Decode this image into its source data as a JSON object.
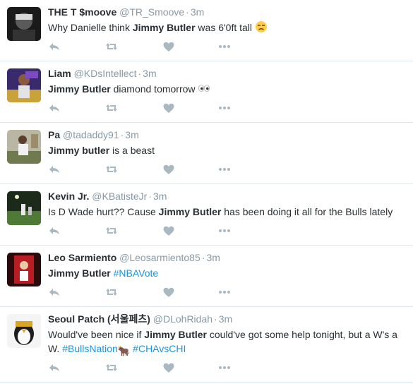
{
  "tweets": [
    {
      "name": "THE T $moove",
      "handle": "@TR_Smoove",
      "time": "3m",
      "parts": [
        {
          "t": "Why Danielle think "
        },
        {
          "t": "Jimmy Butler",
          "b": true
        },
        {
          "t": " was 6'0ft tall "
        }
      ],
      "emoji": "unamused-face-icon"
    },
    {
      "name": "Liam",
      "handle": "@KDsIntellect",
      "time": "3m",
      "parts": [
        {
          "t": "Jimmy Butler",
          "b": true
        },
        {
          "t": " diamond tomorrow "
        }
      ],
      "emoji": "eyes-icon"
    },
    {
      "name": "Pa",
      "handle": "@tadaddy91",
      "time": "3m",
      "parts": [
        {
          "t": "Jimmy butler",
          "b": true
        },
        {
          "t": " is a beast"
        }
      ]
    },
    {
      "name": "Kevin Jr.",
      "handle": "@KBatisteJr",
      "time": "3m",
      "parts": [
        {
          "t": "Is D Wade hurt?? Cause "
        },
        {
          "t": "Jimmy Butler",
          "b": true
        },
        {
          "t": " has been doing it all for the Bulls lately"
        }
      ]
    },
    {
      "name": "Leo Sarmiento",
      "handle": "@Leosarmiento85",
      "time": "3m",
      "parts": [
        {
          "t": "Jimmy Butler",
          "b": true
        },
        {
          "t": " "
        },
        {
          "t": "#NBAVote",
          "h": true
        }
      ]
    },
    {
      "name": "Seoul Patch (서울페츠)",
      "handle": "@DLohRidah",
      "time": "3m",
      "parts": [
        {
          "t": "Would've been nice if "
        },
        {
          "t": "Jimmy Butler",
          "b": true
        },
        {
          "t": " could've got some help tonight, but a W's a W. "
        },
        {
          "t": "#BullsNation",
          "h": true
        },
        {
          "t": "🐂",
          "bull": true
        },
        {
          "t": " "
        },
        {
          "t": "#CHAvsCHI",
          "h": true
        }
      ]
    }
  ],
  "action_icons": [
    "reply-icon",
    "retweet-icon",
    "like-icon",
    "more-icon"
  ],
  "colors": {
    "name": "#292f33",
    "meta": "#8899a6",
    "hashtag": "#1b95e0",
    "icon": "#aab8c2",
    "divider": "#e1e8ed"
  }
}
